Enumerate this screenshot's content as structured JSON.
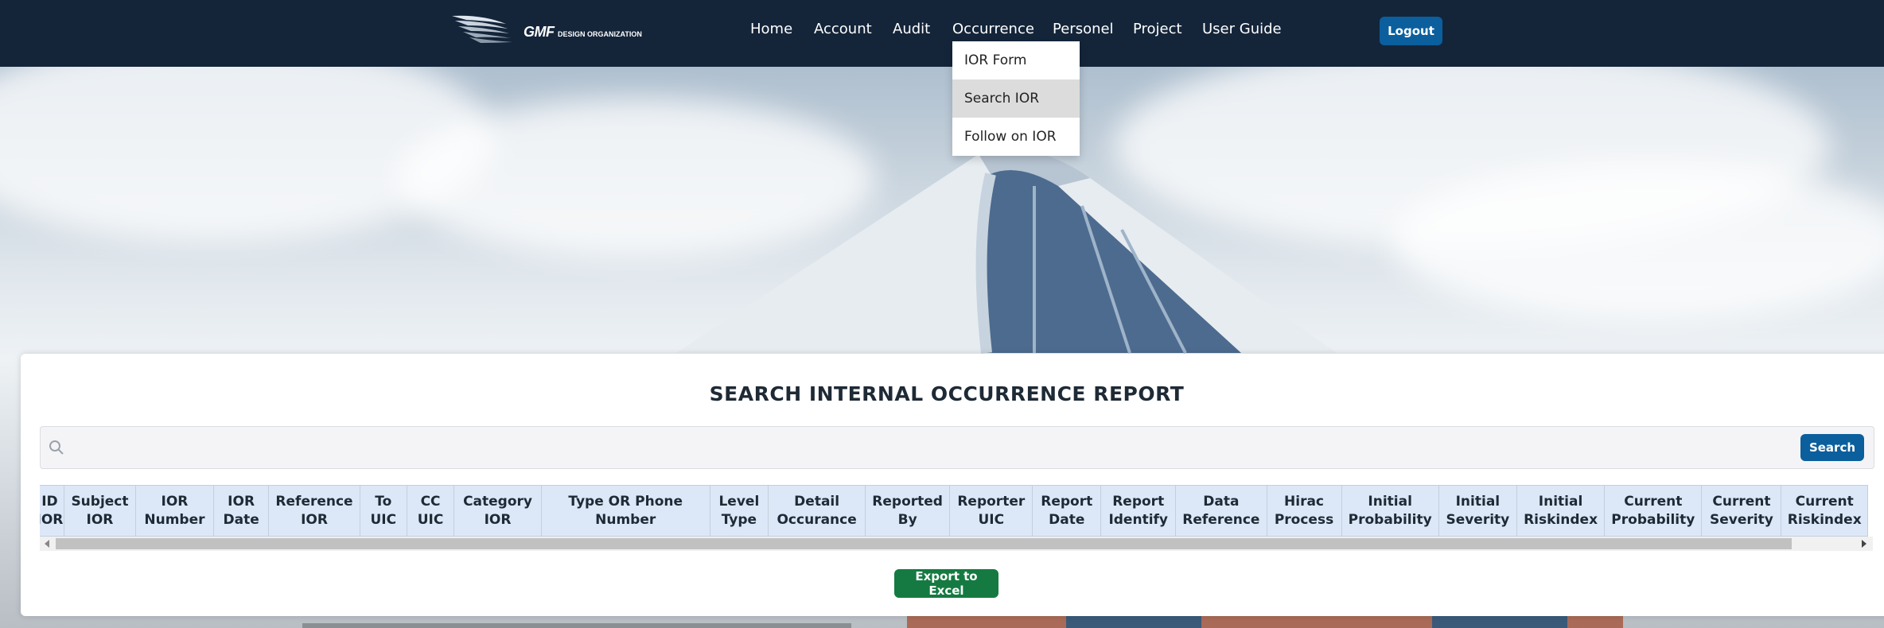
{
  "logo": {
    "text": "GMF",
    "subtext": "DESIGN ORGANIZATION"
  },
  "nav": {
    "home": "Home",
    "account": "Account",
    "audit": "Audit",
    "occurrence": "Occurrence",
    "personel": "Personel",
    "project": "Project",
    "user_guide": "User Guide",
    "logout": "Logout"
  },
  "dropdown": {
    "items": [
      "IOR Form",
      "Search IOR",
      "Follow on IOR"
    ],
    "active_index": 1
  },
  "page": {
    "title": "SEARCH INTERNAL OCCURRENCE REPORT",
    "search_value": "",
    "search_button": "Search",
    "export_button": "Export to Excel"
  },
  "table": {
    "columns": [
      "ID IOR",
      "Subject IOR",
      "IOR Number",
      "IOR Date",
      "Reference IOR",
      "To UIC",
      "CC UIC",
      "Category IOR",
      "Type OR Phone Number",
      "Level Type",
      "Detail Occurance",
      "Reported By",
      "Reporter UIC",
      "Report Date",
      "Report Identify",
      "Data Reference",
      "Hirac Process",
      "Initial Probability",
      "Initial Severity",
      "Initial Riskindex",
      "Current Probability",
      "Current Severity",
      "Current Riskindex"
    ]
  },
  "colors": {
    "navbar": "#14253a",
    "primary_button": "#0b5f9d",
    "export_button": "#157a41",
    "table_header": "#dce8f7"
  }
}
